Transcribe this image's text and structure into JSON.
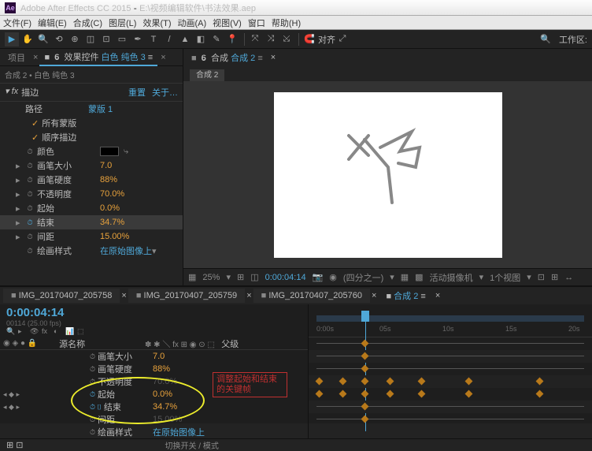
{
  "titlebar": {
    "app": "Adobe After Effects CC 2015",
    "file": "E:\\视频编辑软件\\书法效果.aep"
  },
  "menu": [
    "文件(F)",
    "编辑(E)",
    "合成(C)",
    "图层(L)",
    "效果(T)",
    "动画(A)",
    "视图(V)",
    "窗口",
    "帮助(H)"
  ],
  "toolbar": {
    "snap_label": "对齐",
    "workspace": "工作区:"
  },
  "effect_panel": {
    "tabs": {
      "project": "项目",
      "controls_prefix": "效果控件",
      "controls_link": "白色 纯色 3"
    },
    "breadcrumb": "合成 2 • 白色 纯色 3",
    "effect_name": "描边",
    "reset": "重置",
    "about": "关于…",
    "props": {
      "path": "路径",
      "mask_default": "蒙版 1",
      "all_masks": "所有蒙版",
      "seq_stroke": "顺序描边",
      "color": "颜色",
      "brush_size": "画笔大小",
      "brush_size_v": "7.0",
      "hardness": "画笔硬度",
      "hardness_v": "88%",
      "opacity": "不透明度",
      "opacity_v": "70.0%",
      "start": "起始",
      "start_v": "0.0%",
      "end": "结束",
      "end_v": "34.7%",
      "spacing": "间距",
      "spacing_v": "15.00%",
      "style": "绘画样式",
      "style_v": "在原始图像上"
    }
  },
  "comp_panel": {
    "tab_prefix": "合成",
    "tab_link": "合成 2",
    "crumb": "合成 2"
  },
  "viewer_ctrl": {
    "zoom": "25%",
    "time": "0:00:04:14",
    "res": "(四分之一)",
    "cam": "活动摄像机",
    "views": "1个视图"
  },
  "timeline": {
    "tabs": [
      "IMG_20170407_205758",
      "IMG_20170407_205759",
      "IMG_20170407_205760"
    ],
    "tab_active_prefix": "合成 2",
    "timecode": "0:00:04:14",
    "frame_info": "00114 (25.00 fps)",
    "col_src": "源名称",
    "col_parent": "父级",
    "ruler": [
      "0:00s",
      "05s",
      "10s",
      "15s",
      "20s"
    ],
    "rows": {
      "brush_size": "画笔大小",
      "brush_size_v": "7.0",
      "hardness": "画笔硬度",
      "hardness_v": "88%",
      "opacity": "不透明度",
      "opacity_v": "70.0%",
      "start": "起始",
      "start_v": "0.0%",
      "end": "结束",
      "end_v": "34.7%",
      "spacing": "间距",
      "spacing_v": "15.00%",
      "style": "绘画样式",
      "style_v": "在原始图像上"
    },
    "annotation": "调整起始和结束的关键帧",
    "footer": "切换开关 / 模式"
  }
}
